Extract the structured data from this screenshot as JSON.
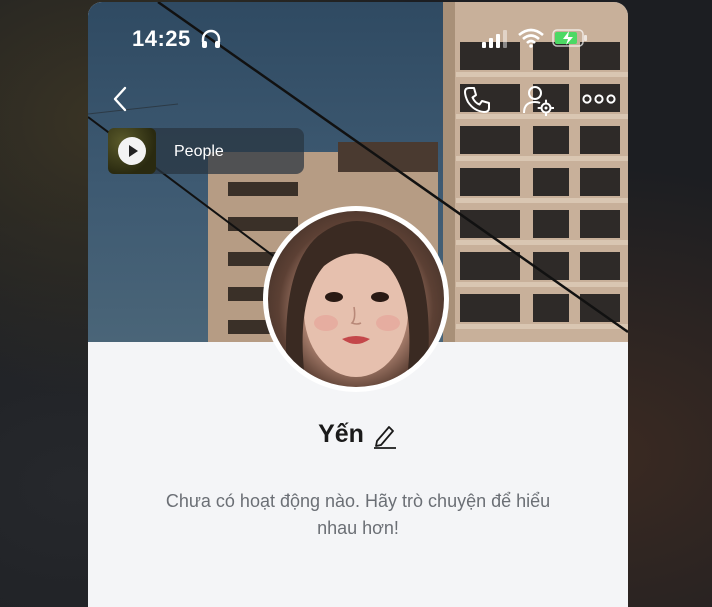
{
  "status_bar": {
    "time": "14:25"
  },
  "header": {
    "back_icon": "chevron-left-icon",
    "actions": [
      {
        "icon": "phone-icon"
      },
      {
        "icon": "user-settings-icon"
      },
      {
        "icon": "more-icon"
      }
    ]
  },
  "music": {
    "label": "People",
    "icon": "play-icon"
  },
  "profile": {
    "name": "Yến",
    "edit_icon": "pencil-icon"
  },
  "timeline": {
    "empty_line1": "Chưa có hoạt động nào. Hãy trò chuyện để hiểu",
    "empty_line2": "nhau hơn!"
  },
  "colors": {
    "status_text": "#ffffff",
    "name_text": "#1a1a1a",
    "empty_text": "#6b6f75",
    "battery_fill": "#4cd964",
    "page_bg": "#f4f5f7"
  }
}
